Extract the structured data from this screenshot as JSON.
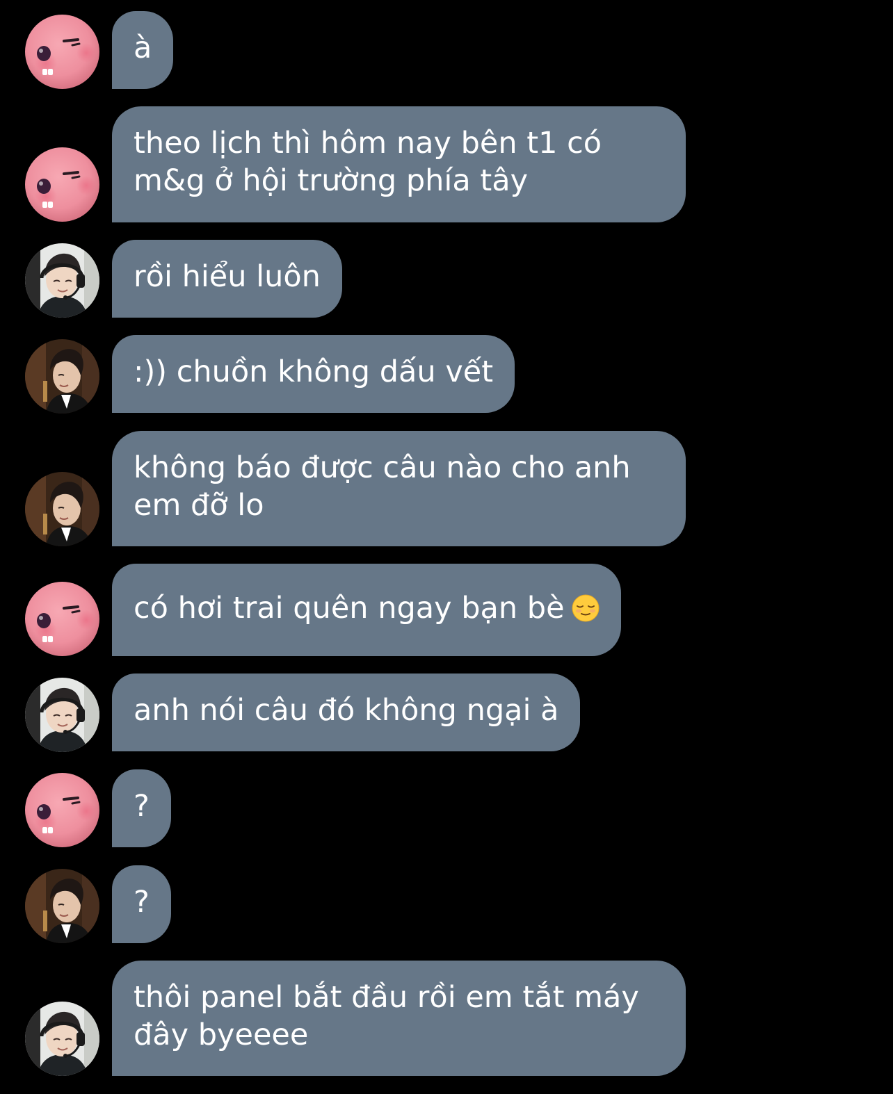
{
  "colors": {
    "background": "#000000",
    "bubble": "#667788",
    "text": "#ffffff"
  },
  "messages": [
    {
      "sender": "pink-creature",
      "text": "à"
    },
    {
      "sender": "pink-creature",
      "text": "theo lịch thì hôm nay bên t1 có m&g ở hội trường phía tây"
    },
    {
      "sender": "headset-boy",
      "text": "rồi hiểu luôn"
    },
    {
      "sender": "suit-boy",
      "text": ":)) chuồn không dấu vết"
    },
    {
      "sender": "suit-boy",
      "text": "không báo được câu nào cho anh em đỡ lo"
    },
    {
      "sender": "pink-creature",
      "text": "có hơi trai quên ngay bạn bè",
      "emoji": "relieved-face"
    },
    {
      "sender": "headset-boy",
      "text": "anh nói câu đó không ngại à"
    },
    {
      "sender": "pink-creature",
      "text": "?"
    },
    {
      "sender": "suit-boy",
      "text": "?"
    },
    {
      "sender": "headset-boy",
      "text": "thôi panel bắt đầu rồi em tắt máy đây byeeee"
    }
  ]
}
